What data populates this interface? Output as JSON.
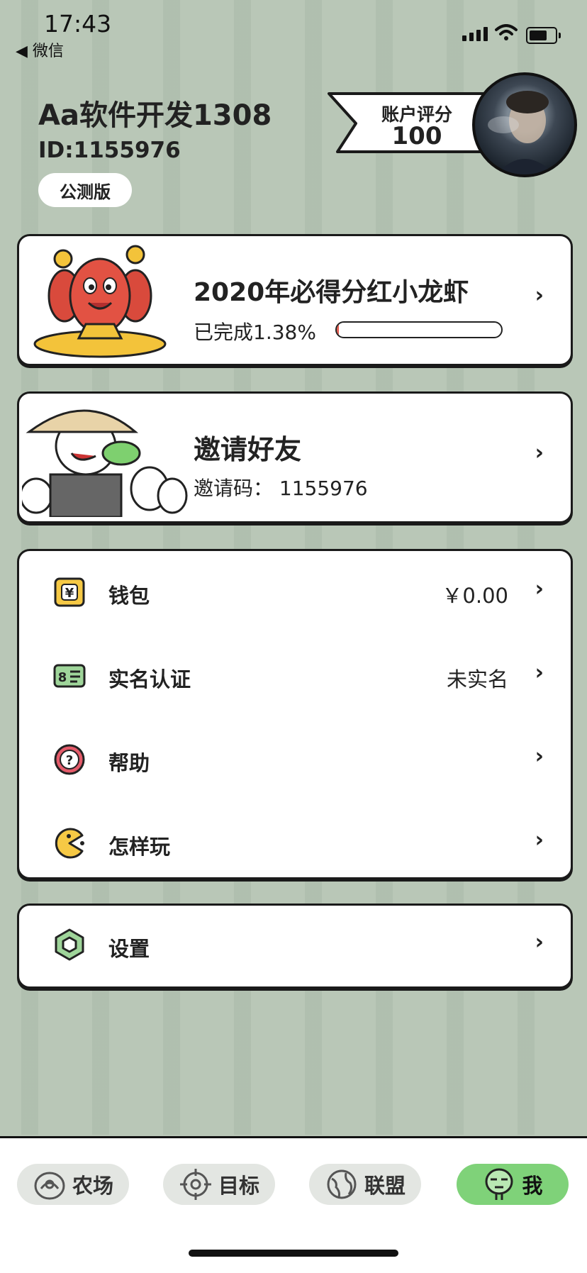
{
  "status": {
    "time": "17:43",
    "back_label": "◀ 微信"
  },
  "profile": {
    "username": "Aa软件开发1308",
    "user_id": "ID:1155976",
    "badge": "公测版",
    "score_label": "账户评分",
    "score_value": "100"
  },
  "lobster_card": {
    "title": "2020年必得分红小龙虾",
    "progress_text": "已完成1.38%",
    "progress_fraction": 0.0138
  },
  "invite_card": {
    "title": "邀请好友",
    "code_text": "邀请码：  1155976"
  },
  "menu": [
    {
      "label": "钱包",
      "value": "￥0.00",
      "icon": "wallet-icon"
    },
    {
      "label": "实名认证",
      "value": "未实名",
      "icon": "id-card-icon"
    },
    {
      "label": "帮助",
      "value": "",
      "icon": "help-icon"
    },
    {
      "label": "怎样玩",
      "value": "",
      "icon": "pacman-icon"
    }
  ],
  "settings": {
    "label": "设置",
    "icon": "hexagon-icon"
  },
  "tabs": [
    {
      "label": "农场",
      "icon": "farm-icon",
      "active": false
    },
    {
      "label": "目标",
      "icon": "target-icon",
      "active": false
    },
    {
      "label": "联盟",
      "icon": "globe-icon",
      "active": false
    },
    {
      "label": "我",
      "icon": "face-icon",
      "active": true
    }
  ],
  "colors": {
    "background": "#b9c7b7",
    "active_tab": "#7fd279",
    "wallet": "#f6c945",
    "help": "#e45b6a",
    "id_card": "#9fd59a"
  }
}
